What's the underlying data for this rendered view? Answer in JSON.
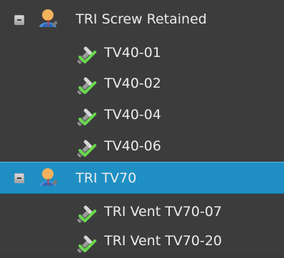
{
  "tree": {
    "items": [
      {
        "label": "TRI Screw Retained",
        "type": "group",
        "expanded": true,
        "selected": false,
        "icon": "user-group-icon"
      },
      {
        "label": "TV40-01",
        "type": "item",
        "selected": false,
        "icon": "implant-check-icon"
      },
      {
        "label": "TV40-02",
        "type": "item",
        "selected": false,
        "icon": "implant-check-icon"
      },
      {
        "label": "TV40-04",
        "type": "item",
        "selected": false,
        "icon": "implant-check-icon"
      },
      {
        "label": "TV40-06",
        "type": "item",
        "selected": false,
        "icon": "implant-check-icon"
      },
      {
        "label": "TRI TV70",
        "type": "group",
        "expanded": true,
        "selected": true,
        "icon": "user-group-icon"
      },
      {
        "label": "TRI Vent TV70-07",
        "type": "item",
        "selected": false,
        "icon": "implant-check-icon"
      },
      {
        "label": "TRI Vent TV70-20",
        "type": "item",
        "selected": false,
        "icon": "implant-check-icon"
      }
    ]
  },
  "colors": {
    "background": "#3c3c3c",
    "selected_row": "#1f8fc3",
    "text": "#ececec",
    "check": "#68d84d"
  }
}
